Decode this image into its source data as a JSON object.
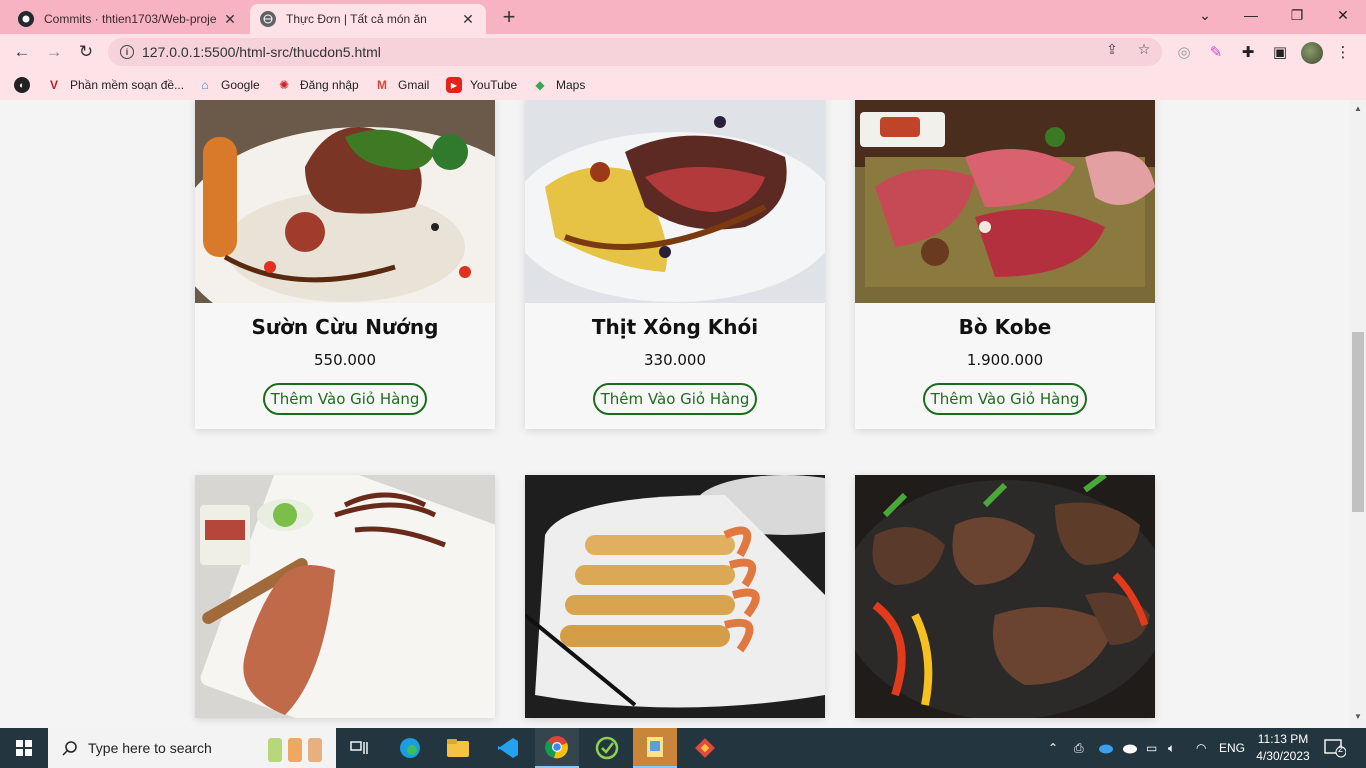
{
  "browser": {
    "tabs": [
      {
        "title": "Commits · thtien1703/Web-proje",
        "active": false
      },
      {
        "title": "Thực Đơn | Tất cả món ăn",
        "active": true
      }
    ],
    "url": "127.0.0.1:5500/html-src/thucdon5.html",
    "bookmarks": [
      {
        "label": "Phần mềm soạn đề...",
        "icon": "v-icon"
      },
      {
        "label": "Google",
        "icon": "google-icon"
      },
      {
        "label": "Đăng nhập",
        "icon": "login-icon"
      },
      {
        "label": "Gmail",
        "icon": "gmail-icon"
      },
      {
        "label": "YouTube",
        "icon": "youtube-icon"
      },
      {
        "label": "Maps",
        "icon": "maps-icon"
      }
    ]
  },
  "menu": {
    "items": [
      {
        "name": "Sườn Cừu Nướng",
        "price": "550.000",
        "button": "Thêm Vào Giỏ Hàng",
        "image": "lamb-rack"
      },
      {
        "name": "Thịt Xông Khói",
        "price": "330.000",
        "button": "Thêm Vào Giỏ Hàng",
        "image": "smoked-beef"
      },
      {
        "name": "Bò Kobe",
        "price": "1.900.000",
        "button": "Thêm Vào Giỏ Hàng",
        "image": "kobe-platter"
      },
      {
        "image": "grilled-squid"
      },
      {
        "image": "shrimp-rolls"
      },
      {
        "image": "beef-rolls"
      }
    ]
  },
  "taskbar": {
    "search_placeholder": "Type here to search",
    "language": "ENG",
    "time": "11:13 PM",
    "date": "4/30/2023",
    "notification_count": "2"
  }
}
